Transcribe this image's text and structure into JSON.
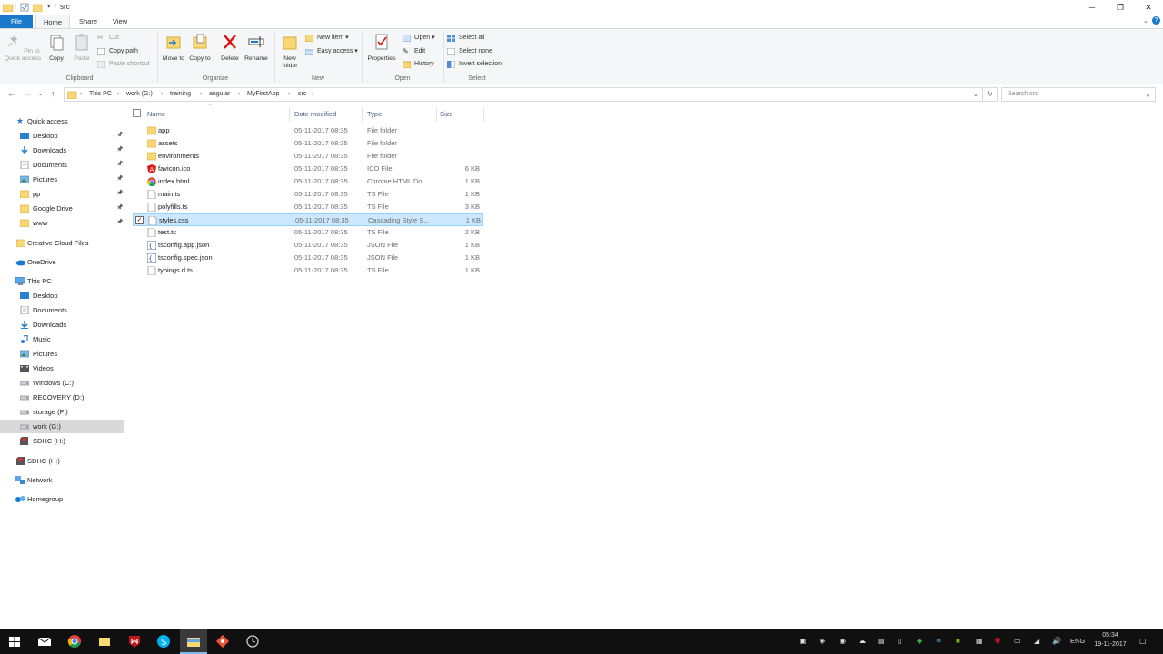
{
  "window": {
    "title": "src"
  },
  "ribbon_tabs": [
    "File",
    "Home",
    "Share",
    "View"
  ],
  "ribbon": {
    "clipboard": {
      "label": "Clipboard",
      "pin": "Pin to Quick access",
      "copy": "Copy",
      "paste": "Paste",
      "cut": "Cut",
      "copy_path": "Copy path",
      "paste_shortcut": "Paste shortcut"
    },
    "organize": {
      "label": "Organize",
      "move_to": "Move to",
      "copy_to": "Copy to",
      "delete": "Delete",
      "rename": "Rename"
    },
    "new": {
      "label": "New",
      "new_folder": "New folder",
      "new_item": "New item",
      "easy_access": "Easy access"
    },
    "open": {
      "label": "Open",
      "properties": "Properties",
      "open": "Open",
      "edit": "Edit",
      "history": "History"
    },
    "select": {
      "label": "Select",
      "select_all": "Select all",
      "select_none": "Select none",
      "invert": "Invert selection"
    }
  },
  "address": {
    "crumbs": [
      "This PC",
      "work (G:)",
      "training",
      "angular",
      "MyFirstApp",
      "src"
    ],
    "search_placeholder": "Search src"
  },
  "nav": {
    "quick_access": "Quick access",
    "quick_items": [
      {
        "label": "Desktop",
        "icon": "desktop-icon",
        "pinned": true
      },
      {
        "label": "Downloads",
        "icon": "downloads-icon",
        "pinned": true
      },
      {
        "label": "Documents",
        "icon": "documents-icon",
        "pinned": true
      },
      {
        "label": "Pictures",
        "icon": "pictures-icon",
        "pinned": true
      },
      {
        "label": "pp",
        "icon": "folder-icon",
        "pinned": true
      },
      {
        "label": "Google Drive",
        "icon": "folder-icon",
        "pinned": true
      },
      {
        "label": "www",
        "icon": "folder-icon",
        "pinned": true
      }
    ],
    "creative_cloud": "Creative Cloud Files",
    "onedrive": "OneDrive",
    "this_pc": "This PC",
    "pc_items": [
      {
        "label": "Desktop",
        "icon": "desktop-icon"
      },
      {
        "label": "Documents",
        "icon": "documents-icon"
      },
      {
        "label": "Downloads",
        "icon": "downloads-icon"
      },
      {
        "label": "Music",
        "icon": "music-icon"
      },
      {
        "label": "Pictures",
        "icon": "pictures-icon"
      },
      {
        "label": "Videos",
        "icon": "videos-icon"
      },
      {
        "label": "Windows (C:)",
        "icon": "drive-icon"
      },
      {
        "label": "RECOVERY (D:)",
        "icon": "drive-icon"
      },
      {
        "label": "storage (F:)",
        "icon": "drive-icon"
      },
      {
        "label": "work (G:)",
        "icon": "drive-icon",
        "selected": true
      },
      {
        "label": "SDHC (H:)",
        "icon": "sd-card-icon"
      }
    ],
    "sdhc": "SDHC (H:)",
    "network": "Network",
    "homegroup": "Homegroup"
  },
  "columns": {
    "name": "Name",
    "date": "Date modified",
    "type": "Type",
    "size": "Size"
  },
  "files": [
    {
      "name": "app",
      "date": "05-11-2017 08:35",
      "type": "File folder",
      "size": "",
      "icon": "folder-icon"
    },
    {
      "name": "assets",
      "date": "05-11-2017 08:35",
      "type": "File folder",
      "size": "",
      "icon": "folder-icon"
    },
    {
      "name": "environments",
      "date": "05-11-2017 08:35",
      "type": "File folder",
      "size": "",
      "icon": "folder-icon"
    },
    {
      "name": "favicon.ico",
      "date": "05-11-2017 08:35",
      "type": "ICO File",
      "size": "6 KB",
      "icon": "angular-icon"
    },
    {
      "name": "index.html",
      "date": "05-11-2017 08:35",
      "type": "Chrome HTML Do...",
      "size": "1 KB",
      "icon": "chrome-icon"
    },
    {
      "name": "main.ts",
      "date": "05-11-2017 08:35",
      "type": "TS File",
      "size": "1 KB",
      "icon": "file-icon"
    },
    {
      "name": "polyfills.ts",
      "date": "05-11-2017 08:35",
      "type": "TS File",
      "size": "3 KB",
      "icon": "file-icon"
    },
    {
      "name": "styles.css",
      "date": "05-11-2017 08:35",
      "type": "Cascading Style S...",
      "size": "1 KB",
      "icon": "file-icon",
      "selected": true
    },
    {
      "name": "test.ts",
      "date": "05-11-2017 08:35",
      "type": "TS File",
      "size": "2 KB",
      "icon": "file-icon"
    },
    {
      "name": "tsconfig.app.json",
      "date": "05-11-2017 08:35",
      "type": "JSON File",
      "size": "1 KB",
      "icon": "json-icon"
    },
    {
      "name": "tsconfig.spec.json",
      "date": "05-11-2017 08:35",
      "type": "JSON File",
      "size": "1 KB",
      "icon": "json-icon"
    },
    {
      "name": "typings.d.ts",
      "date": "05-11-2017 08:35",
      "type": "TS File",
      "size": "1 KB",
      "icon": "file-icon"
    }
  ],
  "taskbar": {
    "apps": [
      "start-icon",
      "mail-icon",
      "chrome-icon",
      "file-explorer-icon",
      "mcafee-icon",
      "skype-icon",
      "explorer-active-icon",
      "git-icon",
      "clock-app-icon"
    ],
    "lang": "ENG",
    "time": "05:34",
    "date": "19-11-2017"
  },
  "colors": {
    "accent": "#1979ca",
    "selection": "#cce8ff",
    "folder": "#f8d775",
    "taskbar": "#101010"
  }
}
